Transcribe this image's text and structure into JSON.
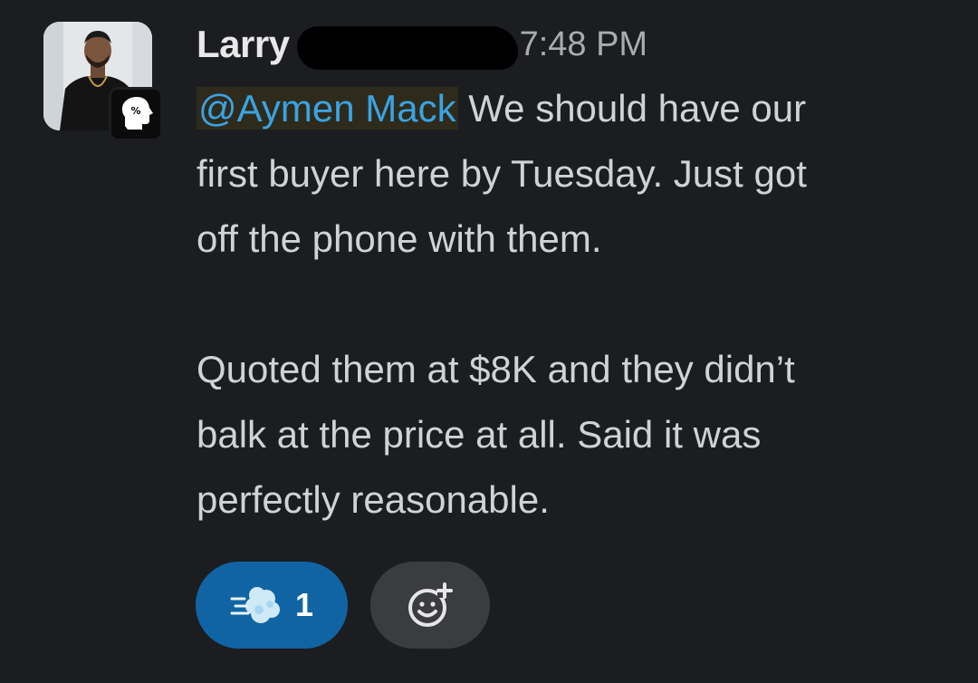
{
  "message": {
    "author": "Larry",
    "time": "7:48 PM",
    "mention": "@Aymen Mack",
    "line1_rest": " We should have our",
    "line2": "first buyer here by Tuesday. Just got",
    "line3": "off the phone with them.",
    "line4": "Quoted them at $8K and they didn’t",
    "line5": "balk at the price at all. Said it was",
    "line6": "perfectly reasonable."
  },
  "reactions": [
    {
      "icon": "dash-emoji-icon",
      "count": "1"
    }
  ],
  "colors": {
    "background": "#1b1d21",
    "mention": "#3aa3e3",
    "reaction_active": "#1164a3",
    "add_reaction": "#3a3c40"
  }
}
